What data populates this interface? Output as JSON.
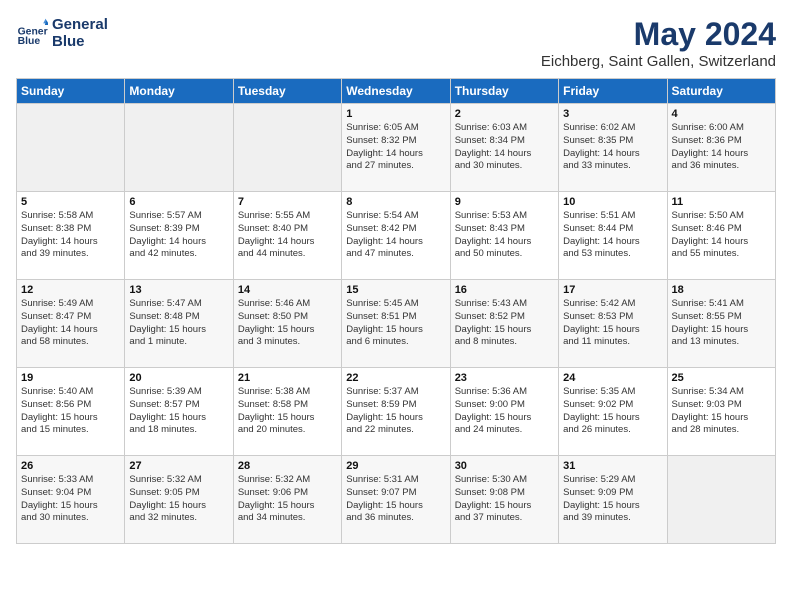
{
  "header": {
    "logo_line1": "General",
    "logo_line2": "Blue",
    "title": "May 2024",
    "subtitle": "Eichberg, Saint Gallen, Switzerland"
  },
  "weekdays": [
    "Sunday",
    "Monday",
    "Tuesday",
    "Wednesday",
    "Thursday",
    "Friday",
    "Saturday"
  ],
  "weeks": [
    [
      {
        "day": "",
        "info": ""
      },
      {
        "day": "",
        "info": ""
      },
      {
        "day": "",
        "info": ""
      },
      {
        "day": "1",
        "info": "Sunrise: 6:05 AM\nSunset: 8:32 PM\nDaylight: 14 hours\nand 27 minutes."
      },
      {
        "day": "2",
        "info": "Sunrise: 6:03 AM\nSunset: 8:34 PM\nDaylight: 14 hours\nand 30 minutes."
      },
      {
        "day": "3",
        "info": "Sunrise: 6:02 AM\nSunset: 8:35 PM\nDaylight: 14 hours\nand 33 minutes."
      },
      {
        "day": "4",
        "info": "Sunrise: 6:00 AM\nSunset: 8:36 PM\nDaylight: 14 hours\nand 36 minutes."
      }
    ],
    [
      {
        "day": "5",
        "info": "Sunrise: 5:58 AM\nSunset: 8:38 PM\nDaylight: 14 hours\nand 39 minutes."
      },
      {
        "day": "6",
        "info": "Sunrise: 5:57 AM\nSunset: 8:39 PM\nDaylight: 14 hours\nand 42 minutes."
      },
      {
        "day": "7",
        "info": "Sunrise: 5:55 AM\nSunset: 8:40 PM\nDaylight: 14 hours\nand 44 minutes."
      },
      {
        "day": "8",
        "info": "Sunrise: 5:54 AM\nSunset: 8:42 PM\nDaylight: 14 hours\nand 47 minutes."
      },
      {
        "day": "9",
        "info": "Sunrise: 5:53 AM\nSunset: 8:43 PM\nDaylight: 14 hours\nand 50 minutes."
      },
      {
        "day": "10",
        "info": "Sunrise: 5:51 AM\nSunset: 8:44 PM\nDaylight: 14 hours\nand 53 minutes."
      },
      {
        "day": "11",
        "info": "Sunrise: 5:50 AM\nSunset: 8:46 PM\nDaylight: 14 hours\nand 55 minutes."
      }
    ],
    [
      {
        "day": "12",
        "info": "Sunrise: 5:49 AM\nSunset: 8:47 PM\nDaylight: 14 hours\nand 58 minutes."
      },
      {
        "day": "13",
        "info": "Sunrise: 5:47 AM\nSunset: 8:48 PM\nDaylight: 15 hours\nand 1 minute."
      },
      {
        "day": "14",
        "info": "Sunrise: 5:46 AM\nSunset: 8:50 PM\nDaylight: 15 hours\nand 3 minutes."
      },
      {
        "day": "15",
        "info": "Sunrise: 5:45 AM\nSunset: 8:51 PM\nDaylight: 15 hours\nand 6 minutes."
      },
      {
        "day": "16",
        "info": "Sunrise: 5:43 AM\nSunset: 8:52 PM\nDaylight: 15 hours\nand 8 minutes."
      },
      {
        "day": "17",
        "info": "Sunrise: 5:42 AM\nSunset: 8:53 PM\nDaylight: 15 hours\nand 11 minutes."
      },
      {
        "day": "18",
        "info": "Sunrise: 5:41 AM\nSunset: 8:55 PM\nDaylight: 15 hours\nand 13 minutes."
      }
    ],
    [
      {
        "day": "19",
        "info": "Sunrise: 5:40 AM\nSunset: 8:56 PM\nDaylight: 15 hours\nand 15 minutes."
      },
      {
        "day": "20",
        "info": "Sunrise: 5:39 AM\nSunset: 8:57 PM\nDaylight: 15 hours\nand 18 minutes."
      },
      {
        "day": "21",
        "info": "Sunrise: 5:38 AM\nSunset: 8:58 PM\nDaylight: 15 hours\nand 20 minutes."
      },
      {
        "day": "22",
        "info": "Sunrise: 5:37 AM\nSunset: 8:59 PM\nDaylight: 15 hours\nand 22 minutes."
      },
      {
        "day": "23",
        "info": "Sunrise: 5:36 AM\nSunset: 9:00 PM\nDaylight: 15 hours\nand 24 minutes."
      },
      {
        "day": "24",
        "info": "Sunrise: 5:35 AM\nSunset: 9:02 PM\nDaylight: 15 hours\nand 26 minutes."
      },
      {
        "day": "25",
        "info": "Sunrise: 5:34 AM\nSunset: 9:03 PM\nDaylight: 15 hours\nand 28 minutes."
      }
    ],
    [
      {
        "day": "26",
        "info": "Sunrise: 5:33 AM\nSunset: 9:04 PM\nDaylight: 15 hours\nand 30 minutes."
      },
      {
        "day": "27",
        "info": "Sunrise: 5:32 AM\nSunset: 9:05 PM\nDaylight: 15 hours\nand 32 minutes."
      },
      {
        "day": "28",
        "info": "Sunrise: 5:32 AM\nSunset: 9:06 PM\nDaylight: 15 hours\nand 34 minutes."
      },
      {
        "day": "29",
        "info": "Sunrise: 5:31 AM\nSunset: 9:07 PM\nDaylight: 15 hours\nand 36 minutes."
      },
      {
        "day": "30",
        "info": "Sunrise: 5:30 AM\nSunset: 9:08 PM\nDaylight: 15 hours\nand 37 minutes."
      },
      {
        "day": "31",
        "info": "Sunrise: 5:29 AM\nSunset: 9:09 PM\nDaylight: 15 hours\nand 39 minutes."
      },
      {
        "day": "",
        "info": ""
      }
    ]
  ]
}
